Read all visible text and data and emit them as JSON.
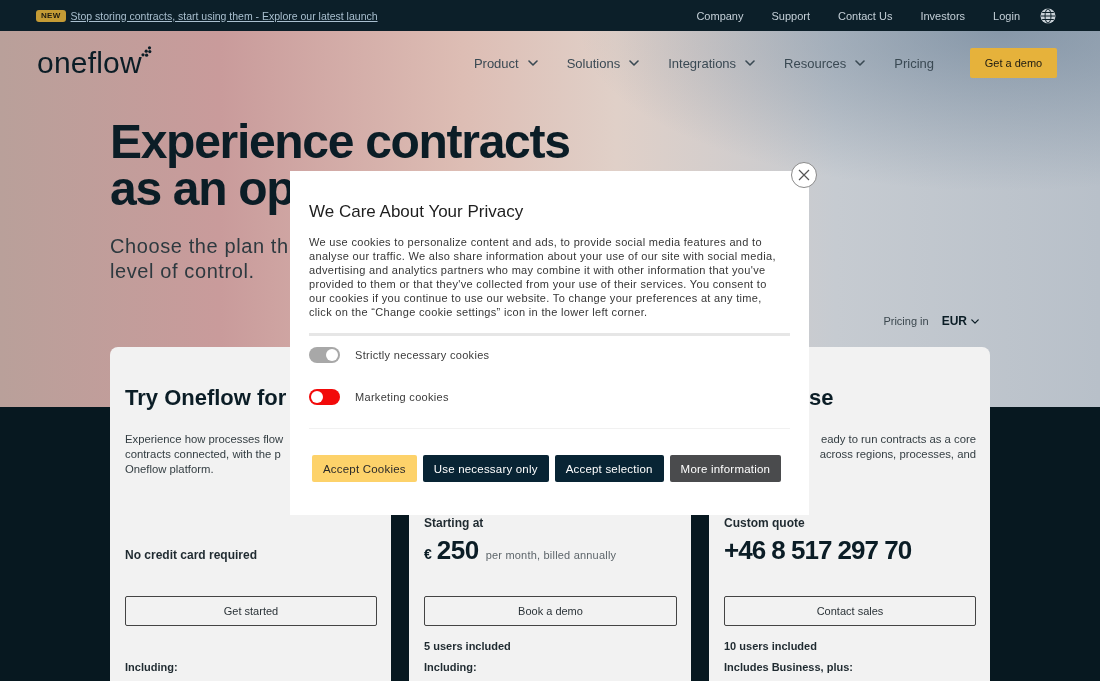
{
  "announcement": {
    "badge": "NEW",
    "link": "Stop storing contracts, start using them - Explore our latest launch"
  },
  "top_links": [
    {
      "label": "Company"
    },
    {
      "label": "Support"
    },
    {
      "label": "Contact Us"
    },
    {
      "label": "Investors"
    },
    {
      "label": "Login"
    }
  ],
  "nav": {
    "logo": "oneflow",
    "items": [
      {
        "label": "Product",
        "dropdown": true
      },
      {
        "label": "Solutions",
        "dropdown": true
      },
      {
        "label": "Integrations",
        "dropdown": true
      },
      {
        "label": "Resources",
        "dropdown": true
      },
      {
        "label": "Pricing",
        "dropdown": false
      }
    ],
    "cta": "Get a demo"
  },
  "hero": {
    "heading_lines": [
      "Experience contracts",
      "as an op"
    ],
    "subtitle_lines": [
      "Choose the plan th",
      "level of control."
    ]
  },
  "currency_picker": {
    "label": "Pricing in",
    "value": "EUR"
  },
  "plans": [
    {
      "title": "Try Oneflow for",
      "description_lines": [
        "Experience how processes flow",
        "contracts connected, with the p",
        "Oneflow platform."
      ],
      "note": "No credit card required",
      "button": "Get started",
      "includes": "Including:"
    },
    {
      "price_label": "Starting at",
      "price": {
        "currency": "€",
        "amount": "250",
        "period": "per month, billed annually"
      },
      "button": "Book a demo",
      "users": "5 users included",
      "includes": "Including:"
    },
    {
      "title": "se",
      "description_lines": [
        "eady to run contracts as a core",
        "across regions, processes, and"
      ],
      "price_label": "Custom quote",
      "price_text": "+46 8 517 297 70",
      "button": "Contact sales",
      "users": "10 users included",
      "includes": "Includes Business, plus:"
    }
  ],
  "cookie_dialog": {
    "title": "We Care About Your Privacy",
    "body": "We use cookies to personalize content and ads, to provide social media features and to analyse our traffic. We also share information about your use of our site with social media, advertising and analytics partners who may combine it with other information that you've provided to them or that they've collected from your use of their services. You consent to our cookies if you continue to use our website. To change your preferences at any time, click on the “Change cookie settings” icon in the lower left corner.",
    "options": [
      {
        "label": "Strictly necessary cookies",
        "on": true,
        "disabled": true
      },
      {
        "label": "Marketing cookies",
        "on": false,
        "disabled": false
      }
    ],
    "buttons": [
      {
        "label": "Accept Cookies",
        "kind": "primary"
      },
      {
        "label": "Use necessary only",
        "kind": "dark"
      },
      {
        "label": "Accept selection",
        "kind": "dark"
      },
      {
        "label": "More information",
        "kind": "neutral"
      }
    ]
  }
}
